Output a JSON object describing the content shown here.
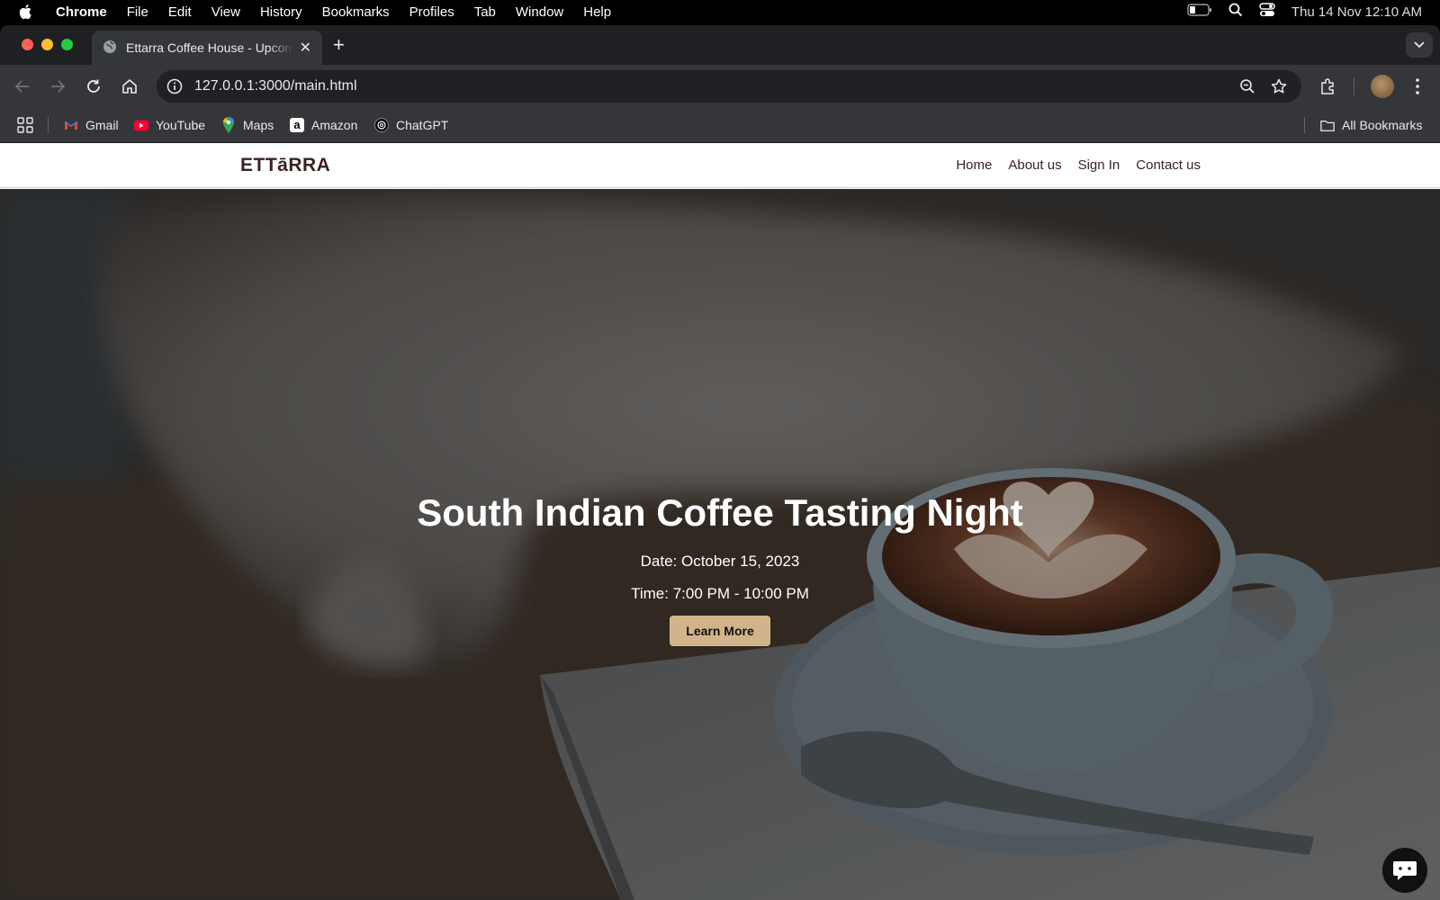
{
  "menubar": {
    "items": [
      "Chrome",
      "File",
      "Edit",
      "View",
      "History",
      "Bookmarks",
      "Profiles",
      "Tab",
      "Window",
      "Help"
    ],
    "clock": "Thu 14 Nov  12:10 AM"
  },
  "browser": {
    "tab_title": "Ettarra Coffee House - Upcoming Events",
    "url": "127.0.0.1:3000/main.html",
    "bookmarks": [
      "Gmail",
      "YouTube",
      "Maps",
      "Amazon",
      "ChatGPT"
    ],
    "all_bookmarks": "All Bookmarks"
  },
  "site": {
    "logo": "ETTāRRA",
    "nav": [
      "Home",
      "About us",
      "Sign In",
      "Contact us"
    ]
  },
  "hero": {
    "title": "South Indian Coffee Tasting Night",
    "date": "Date: October 15, 2023",
    "time": "Time: 7:00 PM - 10:00 PM",
    "button": "Learn More"
  },
  "colors": {
    "brand_text": "#3b2323",
    "button_bg": "#d2b48c",
    "chrome_dark": "#202124",
    "chrome_toolbar": "#35363a"
  }
}
